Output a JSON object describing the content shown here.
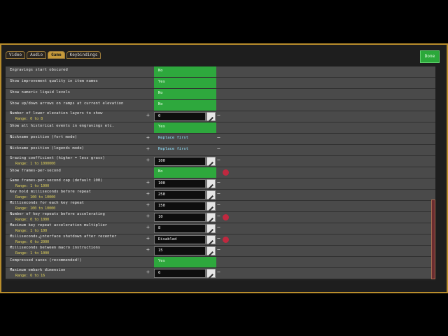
{
  "tabs": [
    "Video",
    "Audio",
    "Game",
    "Keybindings"
  ],
  "done_label": "Done",
  "rows": [
    {
      "label": "Engravings start obscured",
      "value": "No",
      "kind": "bool"
    },
    {
      "label": "Show improvement quality in item names",
      "value": "Yes",
      "kind": "bool"
    },
    {
      "label": "Show numeric liquid levels",
      "value": "No",
      "kind": "bool"
    },
    {
      "label": "Show up/down arrows on ramps at current elevation",
      "value": "No",
      "kind": "bool"
    },
    {
      "label": "Number of lower elevation layers to show",
      "range": "Range: 0 to 8",
      "value": "0",
      "kind": "num"
    },
    {
      "label": "Show all historical events in engravings etc.",
      "value": "Yes",
      "kind": "bool"
    },
    {
      "label": "Nickname position (fort mode)",
      "value": "Replace first",
      "kind": "txt"
    },
    {
      "label": "Nickname position (legends mode)",
      "value": "Replace first",
      "kind": "txt"
    },
    {
      "label": "Grazing coefficient (higher = less grass)",
      "range": "Range: 1 to 1000000",
      "value": "100",
      "kind": "num"
    },
    {
      "label": "Show frames-per-second",
      "value": "No",
      "kind": "bool",
      "marker": true
    },
    {
      "label": "Game frames-per-second cap (default 100)",
      "range": "Range: 1 to 1000",
      "value": "100",
      "kind": "num"
    },
    {
      "label": "Key hold milliseconds before repeat",
      "range": "Range: 100 to 10000",
      "value": "250",
      "kind": "num"
    },
    {
      "label": "Milliseconds for each key repeat",
      "range": "Range: 100 to 10000",
      "value": "150",
      "kind": "num"
    },
    {
      "label": "Number of key repeats before accelerating",
      "range": "Range: 0 to 1000",
      "value": "10",
      "kind": "num",
      "marker": true
    },
    {
      "label": "Maximum key repeat acceleration multiplier",
      "range": "Range: 1 to 100",
      "value": "8",
      "kind": "num"
    },
    {
      "label": "Milliseconds interface shutdown after recenter",
      "range": "Range: 0 to 2000",
      "value": "Disabled",
      "kind": "num",
      "marker": true
    },
    {
      "label": "Milliseconds between macro instructions",
      "range": "Range: 1 to 1000",
      "value": "15",
      "kind": "num"
    },
    {
      "label": "Compressed saves (recommended!)",
      "value": "Yes",
      "kind": "bool"
    },
    {
      "label": "Maximum embark dimension",
      "range": "Range: 6 to 16",
      "value": "6",
      "kind": "num"
    }
  ]
}
